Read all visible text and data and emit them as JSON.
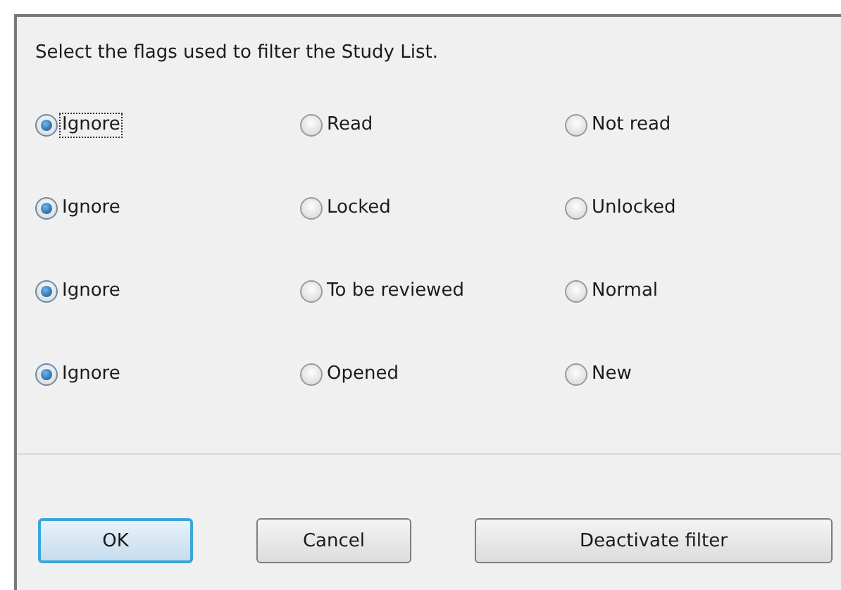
{
  "instruction": "Select the flags used to filter the Study List.",
  "groups": [
    {
      "options": [
        {
          "label": "Ignore",
          "selected": true,
          "focused": true
        },
        {
          "label": "Read",
          "selected": false,
          "focused": false
        },
        {
          "label": "Not read",
          "selected": false,
          "focused": false
        }
      ]
    },
    {
      "options": [
        {
          "label": "Ignore",
          "selected": true,
          "focused": false
        },
        {
          "label": "Locked",
          "selected": false,
          "focused": false
        },
        {
          "label": "Unlocked",
          "selected": false,
          "focused": false
        }
      ]
    },
    {
      "options": [
        {
          "label": "Ignore",
          "selected": true,
          "focused": false
        },
        {
          "label": "To be reviewed",
          "selected": false,
          "focused": false
        },
        {
          "label": "Normal",
          "selected": false,
          "focused": false
        }
      ]
    },
    {
      "options": [
        {
          "label": "Ignore",
          "selected": true,
          "focused": false
        },
        {
          "label": "Opened",
          "selected": false,
          "focused": false
        },
        {
          "label": "New",
          "selected": false,
          "focused": false
        }
      ]
    }
  ],
  "buttons": [
    {
      "label": "OK",
      "default": true
    },
    {
      "label": "Cancel",
      "default": false
    },
    {
      "label": "Deactivate filter",
      "default": false
    }
  ]
}
